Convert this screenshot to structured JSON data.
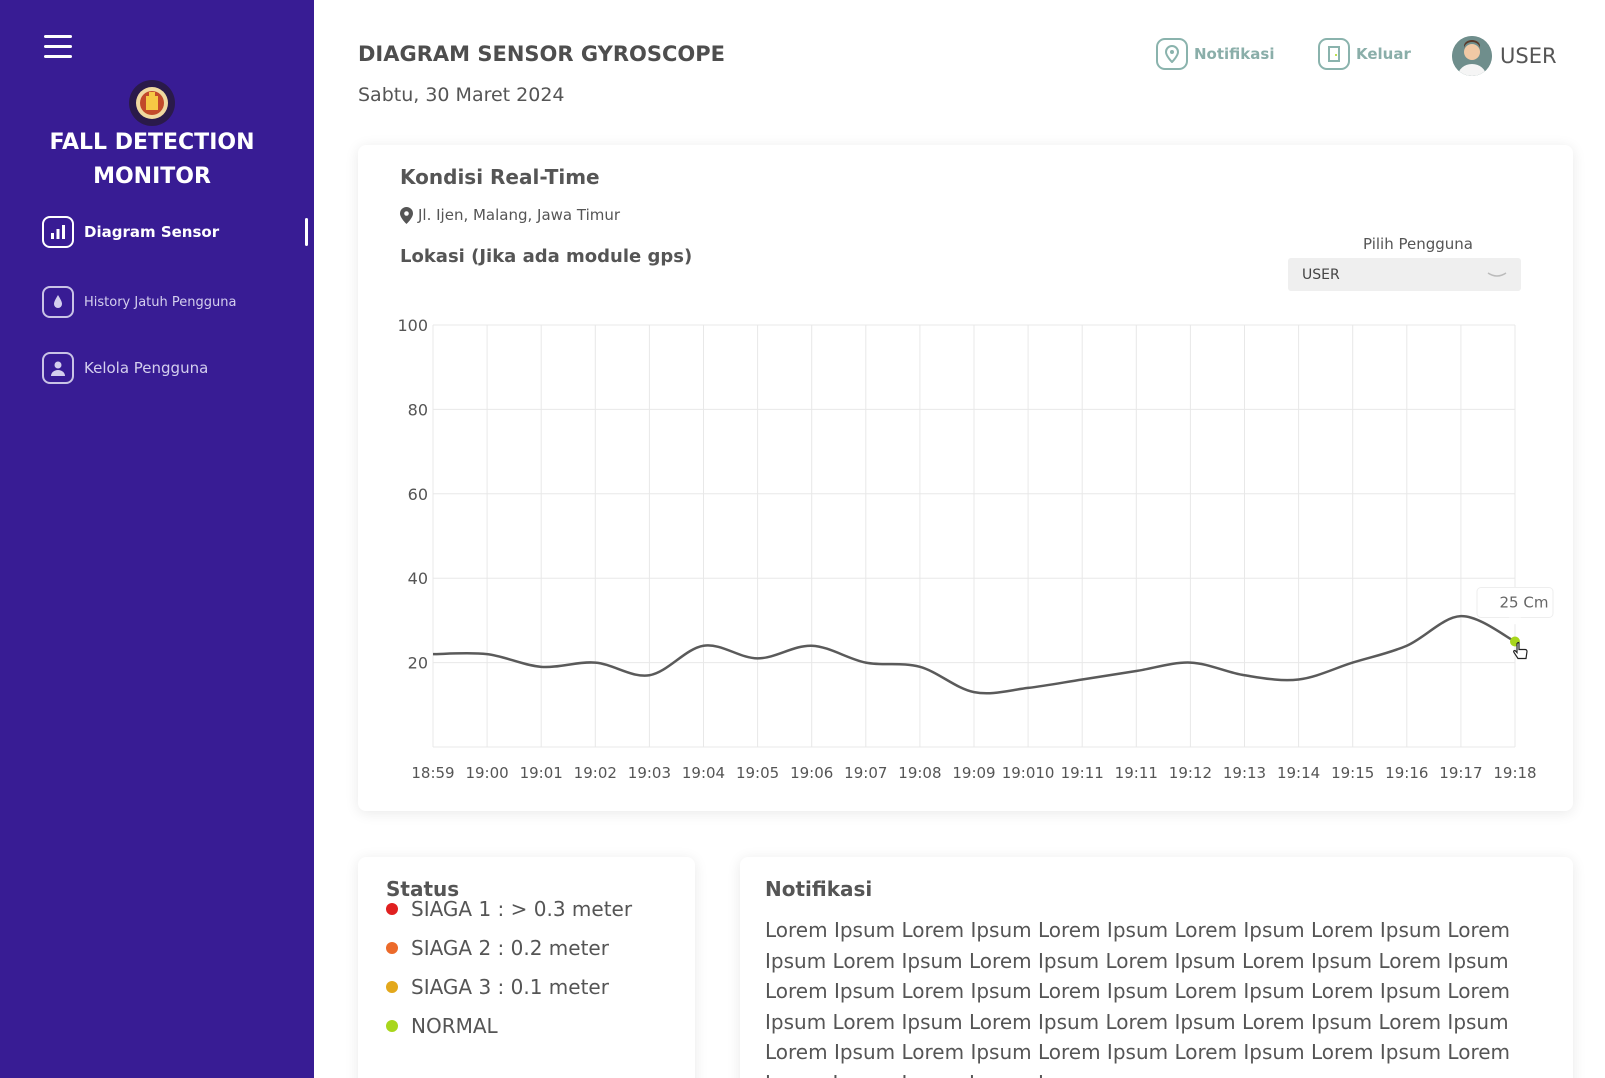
{
  "sidebar": {
    "brand_line1": "FALL DETECTION",
    "brand_line2": "MONITOR",
    "items": [
      {
        "label": "Diagram Sensor",
        "icon": "chart-icon",
        "active": true
      },
      {
        "label": "History Jatuh Pengguna",
        "icon": "history-icon",
        "active": false
      },
      {
        "label": "Kelola Pengguna",
        "icon": "user-icon",
        "active": false
      }
    ],
    "color": "#381c94"
  },
  "header": {
    "title": "DIAGRAM SENSOR GYROSCOPE",
    "date": "Sabtu, 30 Maret 2024",
    "notif_label": "Notifikasi",
    "logout_label": "Keluar",
    "user_label": "USER"
  },
  "realtime": {
    "title": "Kondisi Real-Time",
    "address": "Jl. Ijen, Malang, Jawa Timur",
    "location_title": "Lokasi (Jika ada module gps)",
    "select_label": "Pilih Pengguna",
    "select_value": "USER"
  },
  "chart_data": {
    "type": "line",
    "categories": [
      "18:59",
      "19:00",
      "19:01",
      "19:02",
      "19:03",
      "19:04",
      "19:05",
      "19:06",
      "19:07",
      "19:08",
      "19:09",
      "19:010",
      "19:11",
      "19:11",
      "19:12",
      "19:13",
      "19:14",
      "19:15",
      "19:16",
      "19:17",
      "19:18"
    ],
    "series": [
      {
        "values": [
          22,
          22,
          19,
          20,
          17,
          24,
          21,
          24,
          20,
          19,
          13,
          14,
          16,
          18,
          20,
          17,
          16,
          20,
          24,
          31,
          25
        ]
      }
    ],
    "ylim": [
      0,
      100
    ],
    "yticks": [
      20,
      40,
      60,
      80,
      100
    ],
    "grid": true,
    "tooltip": "25 Cm",
    "line_color": "#5a5a5a",
    "highlight_color": "#a8d61c"
  },
  "status": {
    "title": "Status",
    "items": [
      {
        "label": "SIAGA 1 : > 0.3 meter",
        "color": "#e02020"
      },
      {
        "label": "SIAGA 2 : 0.2 meter",
        "color": "#ec6a2a"
      },
      {
        "label": "SIAGA 3 : 0.1 meter",
        "color": "#e3a81c"
      },
      {
        "label": "NORMAL",
        "color": "#a8d61c"
      }
    ]
  },
  "notifications": {
    "title": "Notifikasi",
    "text": "Lorem Ipsum Lorem Ipsum Lorem Ipsum Lorem Ipsum Lorem Ipsum Lorem Ipsum Lorem Ipsum Lorem Ipsum Lorem Ipsum Lorem Ipsum Lorem Ipsum Lorem Ipsum Lorem Ipsum Lorem Ipsum Lorem Ipsum Lorem Ipsum Lorem Ipsum Lorem Ipsum Lorem Ipsum Lorem Ipsum Lorem Ipsum Lorem Ipsum Lorem Ipsum Lorem Ipsum Lorem Ipsum Lorem Ipsum Lorem Ipsum Lorem Ipsum Lorem Ipsum Lorem Ipsum"
  }
}
